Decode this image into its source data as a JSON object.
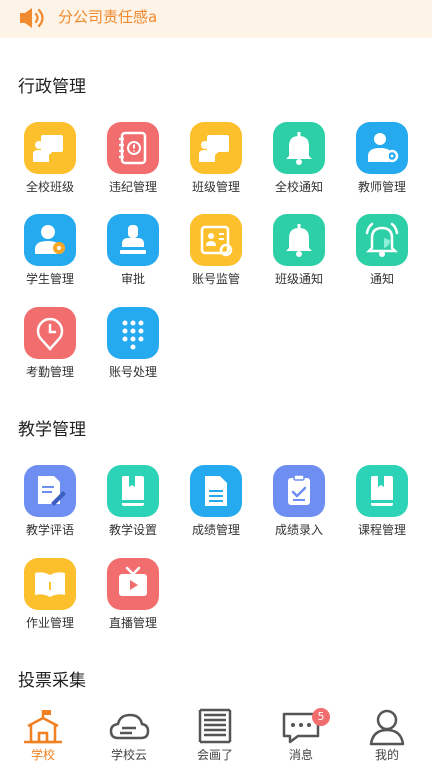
{
  "notice": {
    "text": "分公司责任感a",
    "icon": "speaker-icon",
    "color": "#f18a2e"
  },
  "sections": {
    "admin": {
      "title": "行政管理",
      "items": [
        {
          "label": "全校班级",
          "icon": "teacher-board-icon",
          "color": "#fcc02c"
        },
        {
          "label": "违纪管理",
          "icon": "notebook-alert-icon",
          "color": "#f26d6d"
        },
        {
          "label": "班级管理",
          "icon": "teacher-board-icon",
          "color": "#fcc02c"
        },
        {
          "label": "全校通知",
          "icon": "bell-icon",
          "color": "#2ccfa6"
        },
        {
          "label": "教师管理",
          "icon": "teacher-settings-icon",
          "color": "#25a9ef"
        },
        {
          "label": "学生管理",
          "icon": "student-settings-icon",
          "color": "#25a9ef"
        },
        {
          "label": "审批",
          "icon": "stamp-icon",
          "color": "#25a9ef"
        },
        {
          "label": "账号监管",
          "icon": "id-card-settings-icon",
          "color": "#fcc02c"
        },
        {
          "label": "班级通知",
          "icon": "bell-icon",
          "color": "#2ccfa6"
        },
        {
          "label": "通知",
          "icon": "bell-ring-icon",
          "color": "#2ccfa6"
        },
        {
          "label": "考勤管理",
          "icon": "clock-pin-icon",
          "color": "#f26d6d"
        },
        {
          "label": "账号处理",
          "icon": "keypad-icon",
          "color": "#25a9ef"
        }
      ]
    },
    "teaching": {
      "title": "教学管理",
      "items": [
        {
          "label": "教学评语",
          "icon": "document-pen-icon",
          "color": "#6f8ef2"
        },
        {
          "label": "教学设置",
          "icon": "book-icon",
          "color": "#2cd3b6"
        },
        {
          "label": "成绩管理",
          "icon": "document-lines-icon",
          "color": "#25a9ef"
        },
        {
          "label": "成绩录入",
          "icon": "checklist-icon",
          "color": "#6f8ef2"
        },
        {
          "label": "课程管理",
          "icon": "book-icon",
          "color": "#2cd3b6"
        },
        {
          "label": "作业管理",
          "icon": "open-book-icon",
          "color": "#fcc02c"
        },
        {
          "label": "直播管理",
          "icon": "tv-play-icon",
          "color": "#f26d6d"
        }
      ]
    },
    "vote": {
      "title": "投票采集"
    }
  },
  "bottom_nav": {
    "items": [
      {
        "label": "学校",
        "icon": "school-icon",
        "active": true
      },
      {
        "label": "学校云",
        "icon": "cloud-icon",
        "active": false
      },
      {
        "label": "会画了",
        "icon": "book-stack-icon",
        "active": false
      },
      {
        "label": "消息",
        "icon": "chat-icon",
        "active": false,
        "badge": "5"
      },
      {
        "label": "我的",
        "icon": "user-icon",
        "active": false
      }
    ]
  },
  "colors": {
    "accent": "#f08022",
    "notice_bg": "#fdf3e7"
  }
}
